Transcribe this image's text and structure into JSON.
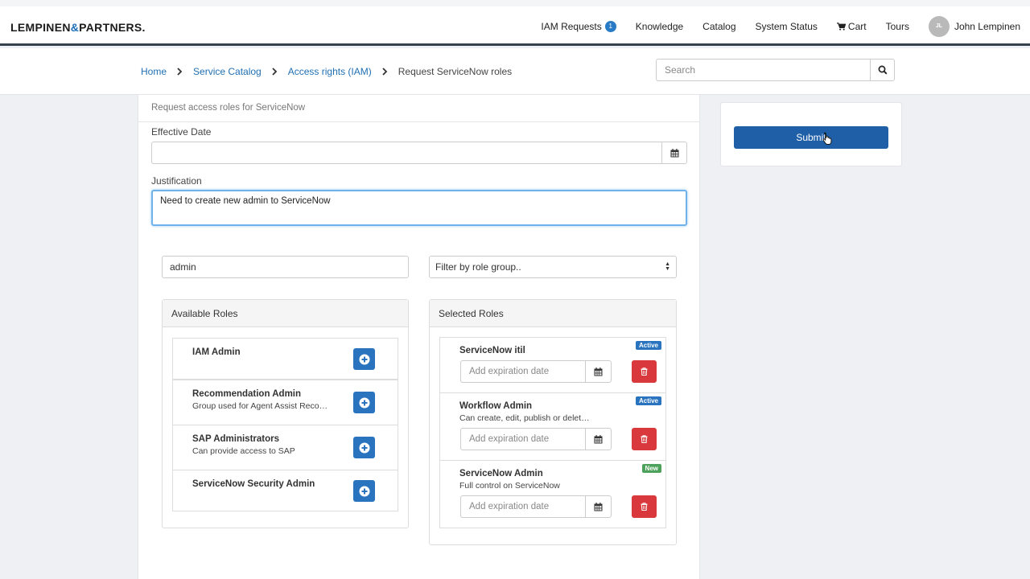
{
  "brand": {
    "name_part1": "LEMPINEN",
    "amp": "&",
    "name_part2": "PARTNERS."
  },
  "nav": {
    "iam_requests": "IAM Requests",
    "iam_count": "1",
    "knowledge": "Knowledge",
    "catalog": "Catalog",
    "system_status": "System Status",
    "cart": "Cart",
    "tours": "Tours",
    "user_initials": "JL",
    "user_name": "John Lempinen"
  },
  "breadcrumb": {
    "home": "Home",
    "service_catalog": "Service Catalog",
    "access_rights": "Access rights (IAM)",
    "current": "Request ServiceNow roles"
  },
  "search": {
    "placeholder": "Search",
    "value": ""
  },
  "form": {
    "description": "Request access roles for ServiceNow",
    "effective_date_label": "Effective Date",
    "effective_date_value": "",
    "justification_label": "Justification",
    "justification_value": "Need to create new admin to ServiceNow",
    "role_search_value": "admin",
    "role_filter_label": "Filter by role group.."
  },
  "available_roles": {
    "title": "Available Roles",
    "items": [
      {
        "name": "IAM Admin",
        "desc": ""
      },
      {
        "name": "Recommendation Admin",
        "desc": "Group used for Agent Assist Reco…"
      },
      {
        "name": "SAP Administrators",
        "desc": "Can provide access to SAP"
      },
      {
        "name": "ServiceNow Security Admin",
        "desc": ""
      }
    ]
  },
  "selected_roles": {
    "title": "Selected Roles",
    "expiration_placeholder": "Add expiration date",
    "items": [
      {
        "name": "ServiceNow itil",
        "desc": "",
        "status": "Active"
      },
      {
        "name": "Workflow Admin",
        "desc": "Can create, edit, publish or delet…",
        "status": "Active"
      },
      {
        "name": "ServiceNow Admin",
        "desc": "Full control on ServiceNow",
        "status": "New"
      }
    ]
  },
  "actions": {
    "submit_label": "Submit"
  },
  "colors": {
    "primary": "#1f5fa8",
    "link": "#1f6fb3",
    "danger": "#d9393c",
    "success": "#4ca25a",
    "header_rule": "#37404d"
  },
  "icons": {
    "search": "search-icon",
    "calendar": "calendar-icon",
    "add": "plus-circle-icon",
    "delete": "trash-icon",
    "cart": "cart-icon"
  }
}
